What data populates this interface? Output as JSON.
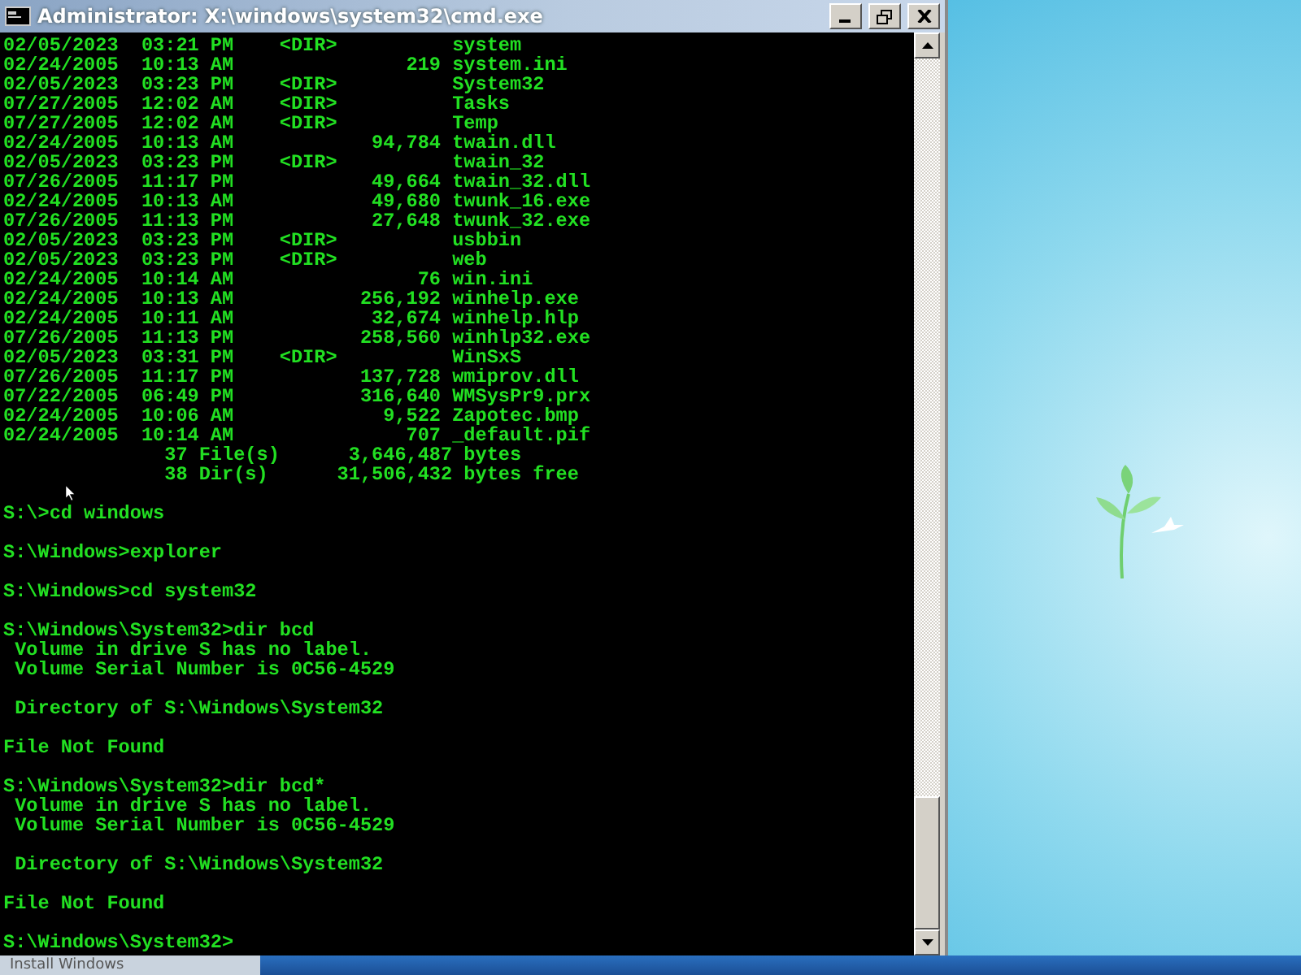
{
  "window": {
    "title": "Administrator: X:\\windows\\system32\\cmd.exe"
  },
  "console_blocks": [
    [
      "02/05/2023  03:21 PM    <DIR>          system",
      "02/24/2005  10:13 AM               219 system.ini",
      "02/05/2023  03:23 PM    <DIR>          System32",
      "07/27/2005  12:02 AM    <DIR>          Tasks",
      "07/27/2005  12:02 AM    <DIR>          Temp",
      "02/24/2005  10:13 AM            94,784 twain.dll",
      "02/05/2023  03:23 PM    <DIR>          twain_32",
      "07/26/2005  11:17 PM            49,664 twain_32.dll",
      "02/24/2005  10:13 AM            49,680 twunk_16.exe",
      "07/26/2005  11:13 PM            27,648 twunk_32.exe",
      "02/05/2023  03:23 PM    <DIR>          usbbin",
      "02/05/2023  03:23 PM    <DIR>          web",
      "02/24/2005  10:14 AM                76 win.ini",
      "02/24/2005  10:13 AM           256,192 winhelp.exe",
      "02/24/2005  10:11 AM            32,674 winhelp.hlp",
      "07/26/2005  11:13 PM           258,560 winhlp32.exe",
      "02/05/2023  03:31 PM    <DIR>          WinSxS",
      "07/26/2005  11:17 PM           137,728 wmiprov.dll",
      "07/22/2005  06:49 PM           316,640 WMSysPr9.prx",
      "02/24/2005  10:06 AM             9,522 Zapotec.bmp",
      "02/24/2005  10:14 AM               707 _default.pif",
      "              37 File(s)      3,646,487 bytes",
      "              38 Dir(s)      31,506,432 bytes free"
    ],
    [
      "S:\\>cd windows"
    ],
    [
      "S:\\Windows>explorer"
    ],
    [
      "S:\\Windows>cd system32"
    ],
    [
      "S:\\Windows\\System32>dir bcd",
      " Volume in drive S has no label.",
      " Volume Serial Number is 0C56-4529"
    ],
    [
      " Directory of S:\\Windows\\System32"
    ],
    [
      "File Not Found"
    ],
    [
      "S:\\Windows\\System32>dir bcd*",
      " Volume in drive S has no label.",
      " Volume Serial Number is 0C56-4529"
    ],
    [
      " Directory of S:\\Windows\\System32"
    ],
    [
      "File Not Found"
    ],
    [
      "S:\\Windows\\System32>"
    ]
  ],
  "taskbar": {
    "button": "Install Windows"
  }
}
